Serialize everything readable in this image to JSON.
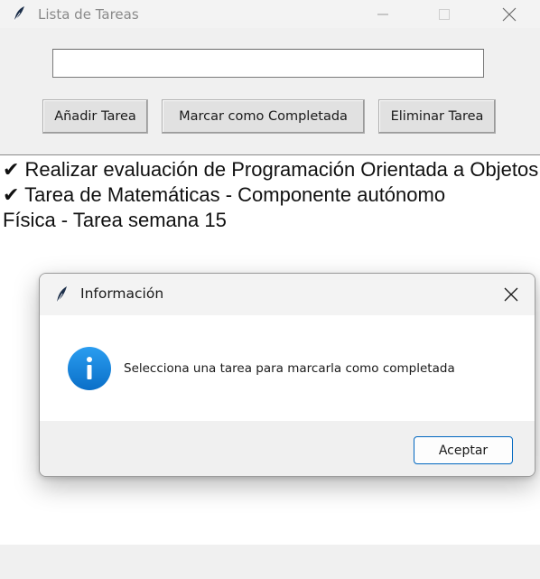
{
  "window": {
    "title": "Lista de Tareas"
  },
  "task_input": {
    "value": ""
  },
  "toolbar": {
    "add_label": "Añadir Tarea",
    "mark_label": "Marcar como Completada",
    "delete_label": "Eliminar Tarea"
  },
  "tasks": [
    {
      "text": "✔ Realizar evaluación de Programación Orientada a Objetos"
    },
    {
      "text": "✔ Tarea de Matemáticas - Componente autónomo"
    },
    {
      "text": "Física - Tarea semana 15"
    }
  ],
  "dialog": {
    "title": "Información",
    "message": "Selecciona una tarea para marcarla como completada",
    "ok_label": "Aceptar"
  },
  "colors": {
    "accent": "#0067c0",
    "info_icon": "#1a8be0"
  },
  "icons": {
    "app": "feather-icon",
    "info": "info-icon"
  }
}
